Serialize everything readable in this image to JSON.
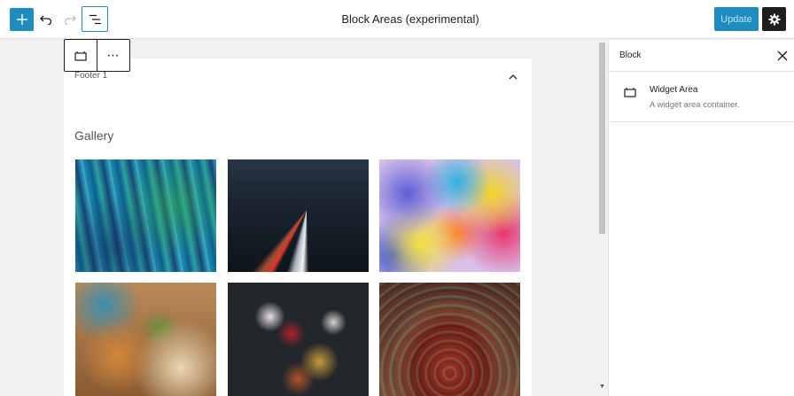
{
  "header": {
    "title": "Block Areas (experimental)",
    "update_label": "Update",
    "icons": {
      "add": "plus-icon",
      "undo": "undo-icon",
      "redo": "redo-icon",
      "navigation": "list-view-icon",
      "settings": "gear-icon"
    }
  },
  "block_toolbar": {
    "type_icon": "widget-area-icon",
    "more_label": "⋯"
  },
  "widget_area": {
    "label": "Footer 1",
    "collapse_icon": "chevron-up-icon"
  },
  "gallery": {
    "heading": "Gallery",
    "images": [
      "abstract-blue-painting",
      "light-trails-highway",
      "watercolor-ink-splash",
      "tacos-plate",
      "spices-in-spoons",
      "red-beans-bowl"
    ]
  },
  "sidebar": {
    "tab_label": "Block",
    "close_icon": "close-icon",
    "block_card": {
      "title": "Widget Area",
      "description": "A widget area container."
    }
  },
  "colors": {
    "accent": "#1e8cbe",
    "settings_bg": "#1e1e1e",
    "canvas_bg": "#f1f1f1"
  }
}
